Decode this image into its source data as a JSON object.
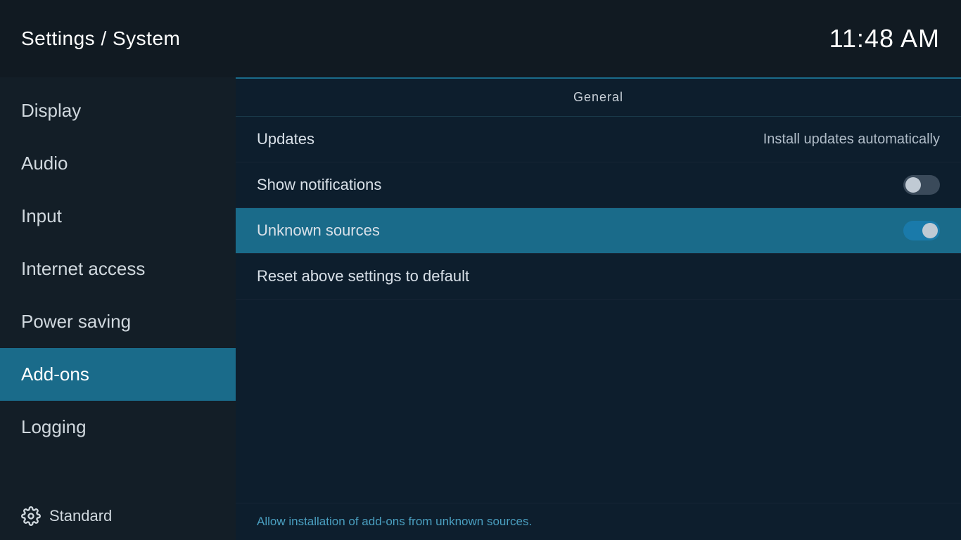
{
  "header": {
    "title": "Settings / System",
    "time": "11:48 AM"
  },
  "sidebar": {
    "items": [
      {
        "id": "display",
        "label": "Display",
        "active": false
      },
      {
        "id": "audio",
        "label": "Audio",
        "active": false
      },
      {
        "id": "input",
        "label": "Input",
        "active": false
      },
      {
        "id": "internet-access",
        "label": "Internet access",
        "active": false
      },
      {
        "id": "power-saving",
        "label": "Power saving",
        "active": false
      },
      {
        "id": "add-ons",
        "label": "Add-ons",
        "active": true
      },
      {
        "id": "logging",
        "label": "Logging",
        "active": false
      }
    ],
    "footer_label": "Standard"
  },
  "content": {
    "section_header": "General",
    "settings": [
      {
        "id": "updates",
        "label": "Updates",
        "value": "Install updates automatically",
        "toggle": null,
        "highlighted": false
      },
      {
        "id": "show-notifications",
        "label": "Show notifications",
        "value": null,
        "toggle": "off",
        "highlighted": false
      },
      {
        "id": "unknown-sources",
        "label": "Unknown sources",
        "value": null,
        "toggle": "on",
        "highlighted": true
      },
      {
        "id": "reset-settings",
        "label": "Reset above settings to default",
        "value": null,
        "toggle": null,
        "highlighted": false
      }
    ],
    "footer_hint": "Allow installation of add-ons from unknown sources."
  }
}
